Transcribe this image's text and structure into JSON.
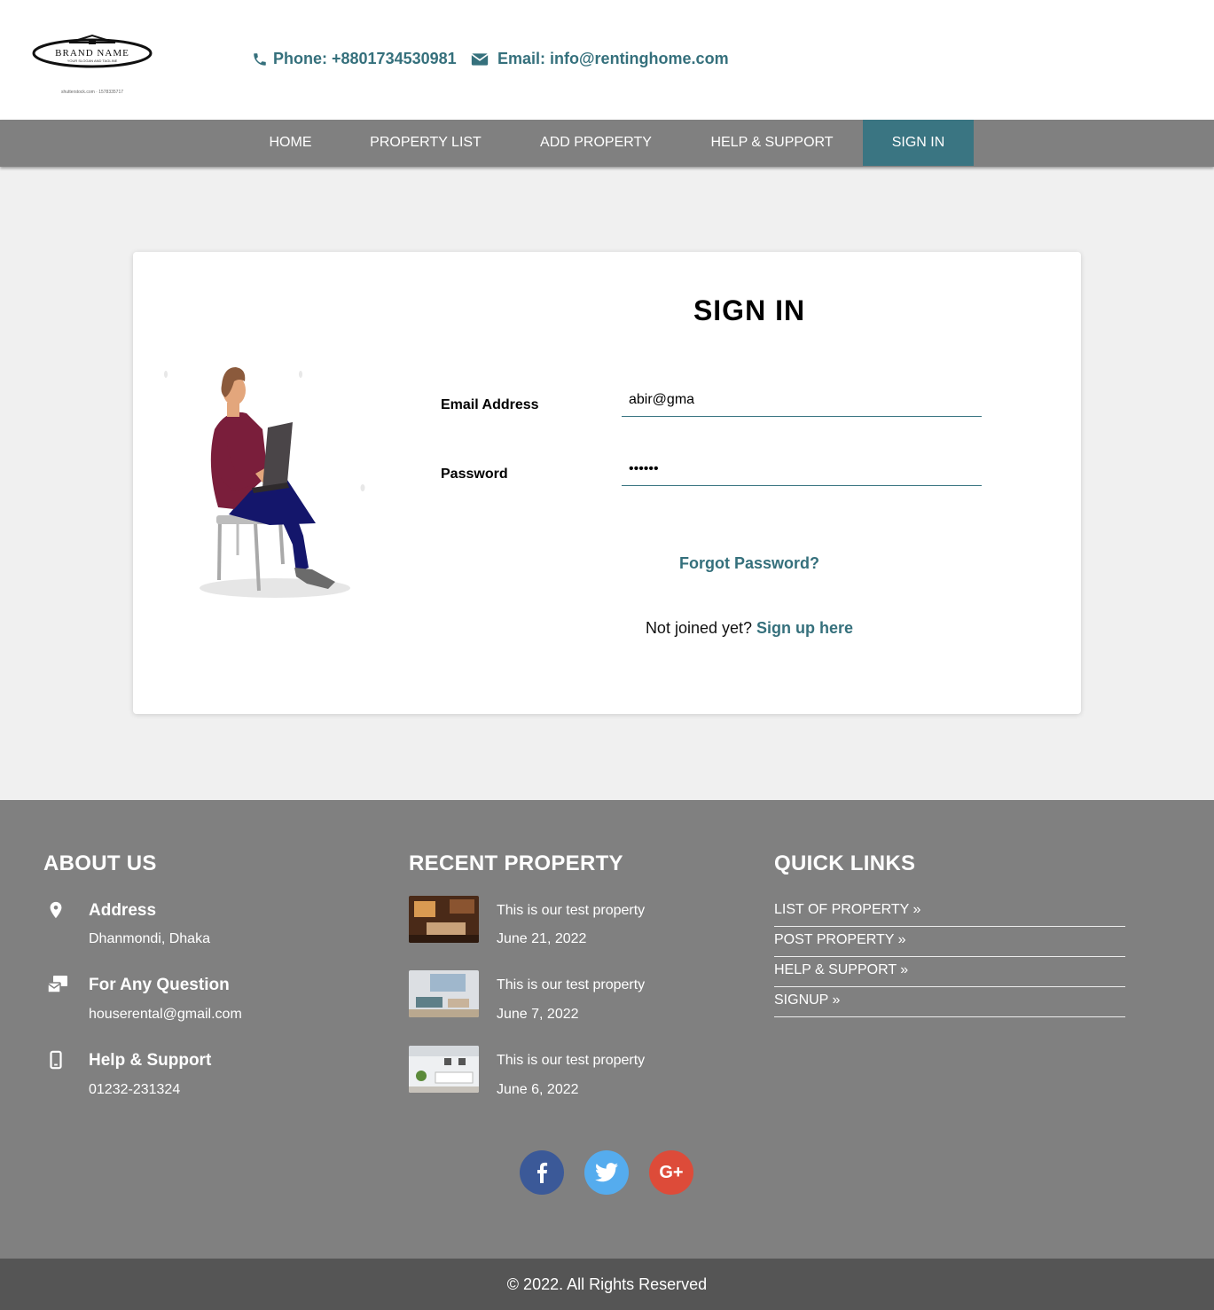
{
  "header": {
    "logo": {
      "brand": "BRAND NAME",
      "tagline": "YOUR SLOGAN AND TAGLINE",
      "watermark": "shutterstock.com · 1578335717"
    },
    "phone": "Phone: +8801734530981",
    "email": "Email: info@rentinghome.com"
  },
  "nav": {
    "items": [
      {
        "label": "HOME",
        "active": false
      },
      {
        "label": "PROPERTY LIST",
        "active": false
      },
      {
        "label": "ADD PROPERTY",
        "active": false
      },
      {
        "label": "HELP & SUPPORT",
        "active": false
      },
      {
        "label": "SIGN IN",
        "active": true
      }
    ]
  },
  "signin": {
    "title": "SIGN IN",
    "email_label": "Email Address",
    "email_value": "abir@gma",
    "password_label": "Password",
    "password_value": "••••••",
    "forgot": "Forgot Password?",
    "signup_prompt": "Not joined yet?",
    "signup_link": "Sign up here"
  },
  "footer": {
    "about": {
      "heading": "ABOUT US",
      "items": [
        {
          "icon": "map-pin-icon",
          "title": "Address",
          "value": "Dhanmondi, Dhaka"
        },
        {
          "icon": "mail-question-icon",
          "title": "For Any Question",
          "value": "houserental@gmail.com"
        },
        {
          "icon": "mobile-phone-icon",
          "title": "Help & Support",
          "value": "01232-231324"
        }
      ]
    },
    "recent": {
      "heading": "RECENT PROPERTY",
      "items": [
        {
          "title": "This is our test property",
          "date": "June 21, 2022"
        },
        {
          "title": "This is our test property",
          "date": "June 7, 2022"
        },
        {
          "title": "This is our test property",
          "date": "June 6, 2022"
        }
      ]
    },
    "quick_links": {
      "heading": "QUICK LINKS",
      "items": [
        "LIST OF PROPERTY »",
        "POST PROPERTY »",
        "HELP & SUPPORT »",
        "SIGNUP »"
      ]
    },
    "social": [
      {
        "name": "facebook-icon",
        "glyph": "f",
        "color": "#3b5998"
      },
      {
        "name": "twitter-icon",
        "glyph": "",
        "color": "#55acee"
      },
      {
        "name": "google-plus-icon",
        "glyph": "G+",
        "color": "#dd4b39"
      }
    ],
    "copyright": "© 2022. All Rights Reserved"
  },
  "colors": {
    "accent": "#35707c",
    "nav_bg": "#808080",
    "nav_active": "#3a7582",
    "footer_bg": "#808080",
    "copyright_bg": "#555555"
  }
}
